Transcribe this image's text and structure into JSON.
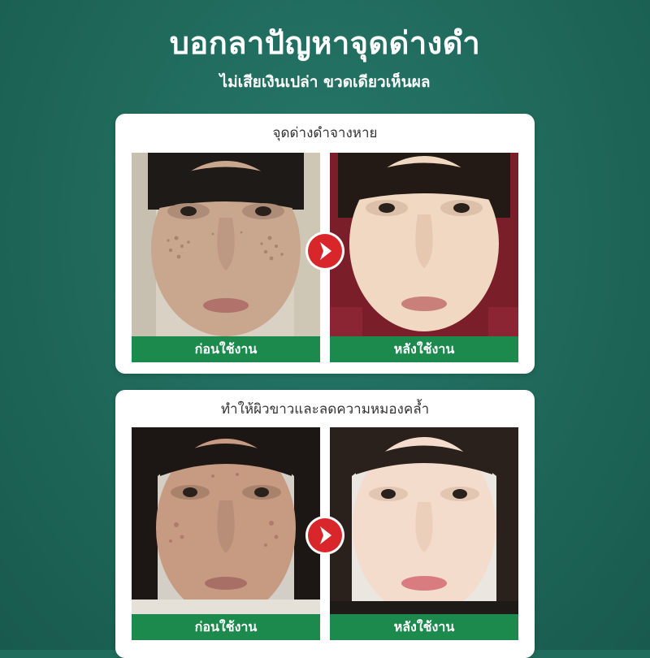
{
  "header": {
    "title": "บอกลาปัญหาจุดด่างดำ",
    "subtitle": "ไม่เสียเงินเปล่า ขวดเดียวเห็นผล"
  },
  "cards": [
    {
      "title": "จุดด่างดำจางหาย",
      "before_label": "ก่อนใช้งาน",
      "after_label": "หลังใช้งาน"
    },
    {
      "title": "ทำให้ผิวขาวและลดความหมองคล้ำ",
      "before_label": "ก่อนใช้งาน",
      "after_label": "หลังใช้งาน"
    }
  ],
  "icons": {
    "arrow": "chevron-right-icon"
  },
  "colors": {
    "background": "#1f6b5c",
    "label_bar": "#1b8a4c",
    "arrow": "#d8262a"
  }
}
